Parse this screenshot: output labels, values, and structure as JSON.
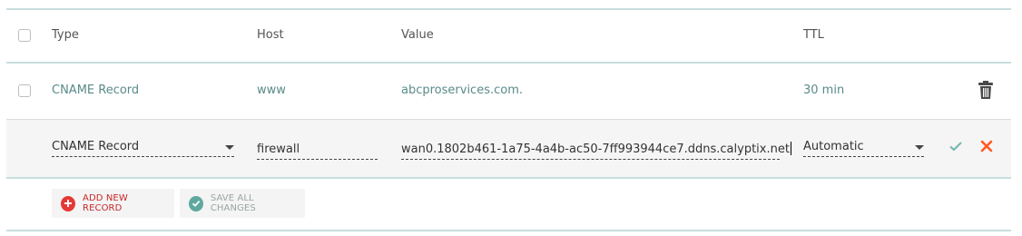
{
  "table": {
    "headers": {
      "type": "Type",
      "host": "Host",
      "value": "Value",
      "ttl": "TTL"
    },
    "rows": [
      {
        "type": "CNAME Record",
        "host": "www",
        "value": "abcproservices.com.",
        "ttl": "30 min"
      }
    ]
  },
  "edit_row": {
    "type": "CNAME Record",
    "host": "firewall",
    "value": "wan0.1802b461-1a75-4a4b-ac50-7ff993944ce7.ddns.calyptix.net",
    "ttl": "Automatic"
  },
  "actions": {
    "add_new_record": "ADD NEW RECORD",
    "save_all_changes": "SAVE ALL CHANGES"
  },
  "colors": {
    "accent_teal": "#5a8a8a",
    "add_red": "#e53935",
    "save_teal": "#5fa8a0",
    "cancel_orange": "#ff5a1f",
    "confirm_green": "#6fb7ad"
  }
}
